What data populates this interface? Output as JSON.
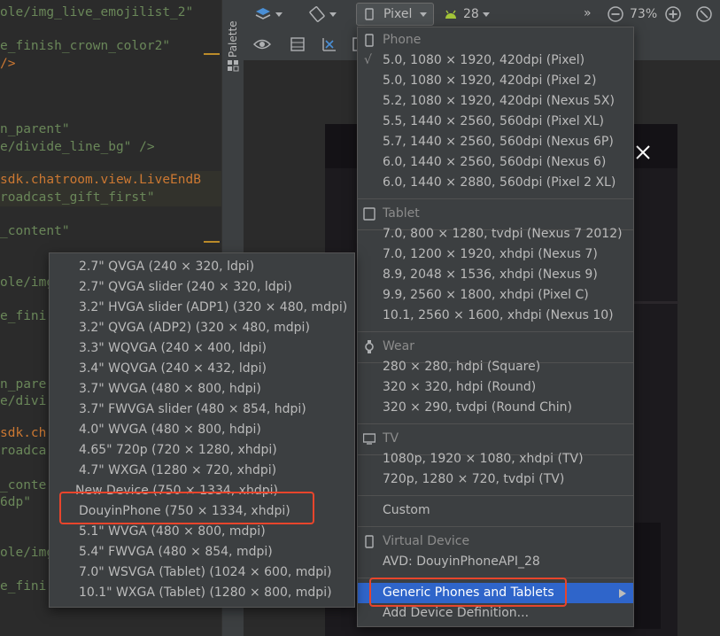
{
  "editor": {
    "lines": [
      {
        "text": "ole/img_live_emojilist_2\"",
        "color": "green"
      },
      {
        "text": "e_finish_crown_color2\"",
        "color": "green"
      },
      {
        "text": "/>",
        "color": "orange"
      },
      {
        "text": "n_parent\"",
        "color": "green"
      },
      {
        "text": "e/divide_line_bg\" />",
        "color": "green"
      },
      {
        "text": "sdk.chatroom.view.LiveEndB",
        "color": "orange"
      },
      {
        "text": "roadcast_gift_first\"",
        "color": "green"
      },
      {
        "text": "_content\"",
        "color": "green"
      },
      {
        "text": "ole/img",
        "color": "green"
      },
      {
        "text": "e_fini",
        "color": "green"
      },
      {
        "text": "n_pare",
        "color": "green"
      },
      {
        "text": "e/divi",
        "color": "green"
      },
      {
        "text": "sdk.ch",
        "color": "orange"
      },
      {
        "text": "roadca",
        "color": "green"
      },
      {
        "text": "_conte",
        "color": "green"
      },
      {
        "text": "6dp\"",
        "color": "green"
      },
      {
        "text": "ole/img",
        "color": "green"
      },
      {
        "text": "e_fini",
        "color": "green"
      }
    ]
  },
  "palette": {
    "label": "Palette"
  },
  "toolbar": {
    "device_label": "Pixel",
    "api_level": "28",
    "zoom": "73%",
    "more_label": "»"
  },
  "device_menu": {
    "items": [
      {
        "kind": "header",
        "label": "Phone",
        "icon": "phone-icon"
      },
      {
        "kind": "item",
        "label": "5.0, 1080 × 1920, 420dpi (Pixel)",
        "checked": true
      },
      {
        "kind": "item",
        "label": "5.0, 1080 × 1920, 420dpi (Pixel 2)"
      },
      {
        "kind": "item",
        "label": "5.2, 1080 × 1920, 420dpi (Nexus 5X)"
      },
      {
        "kind": "item",
        "label": "5.5, 1440 × 2560, 560dpi (Pixel XL)"
      },
      {
        "kind": "item",
        "label": "5.7, 1440 × 2560, 560dpi (Nexus 6P)"
      },
      {
        "kind": "item",
        "label": "6.0, 1440 × 2560, 560dpi (Nexus 6)"
      },
      {
        "kind": "item",
        "label": "6.0, 1440 × 2880, 560dpi (Pixel 2 XL)"
      },
      {
        "kind": "header",
        "label": "Tablet",
        "icon": "tablet-icon"
      },
      {
        "kind": "item",
        "label": "7.0, 800 × 1280, tvdpi (Nexus 7 2012)"
      },
      {
        "kind": "item",
        "label": "7.0, 1200 × 1920, xhdpi (Nexus 7)"
      },
      {
        "kind": "item",
        "label": "8.9, 2048 × 1536, xhdpi (Nexus 9)"
      },
      {
        "kind": "item",
        "label": "9.9, 2560 × 1800, xhdpi (Pixel C)"
      },
      {
        "kind": "item",
        "label": "10.1, 2560 × 1600, xhdpi (Nexus 10)"
      },
      {
        "kind": "header",
        "label": "Wear",
        "icon": "watch-icon"
      },
      {
        "kind": "item",
        "label": "280 × 280, hdpi (Square)"
      },
      {
        "kind": "item",
        "label": "320 × 320, hdpi (Round)"
      },
      {
        "kind": "item",
        "label": "320 × 290, tvdpi (Round Chin)"
      },
      {
        "kind": "header",
        "label": "TV",
        "icon": "tv-icon"
      },
      {
        "kind": "item",
        "label": "1080p, 1920 × 1080, xhdpi (TV)"
      },
      {
        "kind": "item",
        "label": "720p, 1280 × 720, tvdpi (TV)"
      },
      {
        "kind": "item",
        "label": "Custom"
      },
      {
        "kind": "header",
        "label": "Virtual Device",
        "icon": "phone-icon"
      },
      {
        "kind": "item",
        "label": "AVD: DouyinPhoneAPI_28"
      },
      {
        "kind": "submenu",
        "label": "Generic Phones and Tablets",
        "selected": true,
        "highlighted": true
      },
      {
        "kind": "item",
        "label": "Add Device Definition..."
      }
    ]
  },
  "generic_submenu": {
    "items": [
      {
        "label": "2.7\" QVGA (240 × 320, ldpi)"
      },
      {
        "label": "2.7\" QVGA slider (240 × 320, ldpi)"
      },
      {
        "label": "3.2\" HVGA slider (ADP1) (320 × 480, mdpi)"
      },
      {
        "label": "3.2\" QVGA (ADP2) (320 × 480, mdpi)"
      },
      {
        "label": "3.3\" WQVGA (240 × 400, ldpi)"
      },
      {
        "label": "3.4\" WQVGA (240 × 432, ldpi)"
      },
      {
        "label": "3.7\" WVGA (480 × 800, hdpi)"
      },
      {
        "label": "3.7\" FWVGA slider (480 × 854, hdpi)"
      },
      {
        "label": "4.0\" WVGA (480 × 800, hdpi)"
      },
      {
        "label": "4.65\" 720p (720 × 1280, xhdpi)"
      },
      {
        "label": "4.7\" WXGA (1280 × 720, xhdpi)"
      },
      {
        "label": "New Device (750 × 1334, xhdpi)",
        "struck": true
      },
      {
        "label": "DouyinPhone (750 × 1334, xhdpi)",
        "highlighted": true
      },
      {
        "label": "5.1\" WVGA (480 × 800, mdpi)"
      },
      {
        "label": "5.4\" FWVGA (480 × 854, mdpi)"
      },
      {
        "label": "7.0\" WSVGA (Tablet) (1024 × 600, mdpi)"
      },
      {
        "label": "10.1\" WXGA (Tablet) (1280 × 800, mdpi)"
      }
    ]
  },
  "colors": {
    "highlight_box": "#e8452c",
    "selection_bg": "#2f65ca",
    "menu_bg": "#3c3f41",
    "android_green": "#a4c639"
  }
}
